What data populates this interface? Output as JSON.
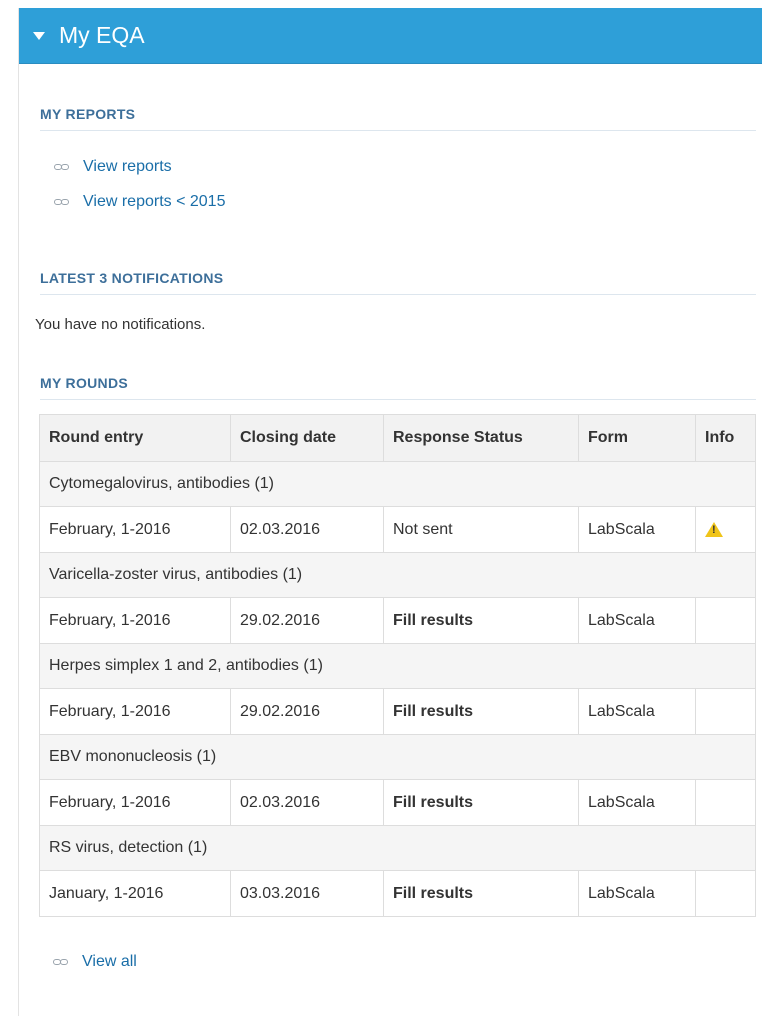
{
  "panel": {
    "title": "My EQA"
  },
  "reports": {
    "heading": "MY REPORTS",
    "links": [
      {
        "label": "View reports"
      },
      {
        "label": "View reports < 2015"
      }
    ]
  },
  "notifications": {
    "heading": "LATEST 3 NOTIFICATIONS",
    "empty_text": "You have no notifications."
  },
  "rounds": {
    "heading": "MY ROUNDS",
    "columns": [
      "Round entry",
      "Closing date",
      "Response Status",
      "Form",
      "Info"
    ],
    "groups": [
      {
        "name": "Cytomegalovirus, antibodies (1)",
        "entry": "February, 1-2016",
        "closing": "02.03.2016",
        "status": "Not sent",
        "status_type": "notsent",
        "form": "LabScala",
        "info": "warning-icon"
      },
      {
        "name": "Varicella-zoster virus, antibodies (1)",
        "entry": "February, 1-2016",
        "closing": "29.02.2016",
        "status": "Fill results",
        "status_type": "fill",
        "form": "LabScala",
        "info": ""
      },
      {
        "name": "Herpes simplex 1 and 2, antibodies (1)",
        "entry": "February, 1-2016",
        "closing": "29.02.2016",
        "status": "Fill results",
        "status_type": "fill",
        "form": "LabScala",
        "info": ""
      },
      {
        "name": "EBV mononucleosis (1)",
        "entry": "February, 1-2016",
        "closing": "02.03.2016",
        "status": "Fill results",
        "status_type": "fill",
        "form": "LabScala",
        "info": ""
      },
      {
        "name": "RS virus, detection (1)",
        "entry": "January, 1-2016",
        "closing": "03.03.2016",
        "status": "Fill results",
        "status_type": "fill",
        "form": "LabScala",
        "info": ""
      }
    ],
    "view_all": "View all"
  },
  "colors": {
    "header_bg": "#2e9fd8",
    "link": "#1a6ea8",
    "section_heading": "#3d6f9a",
    "not_sent": "#e04a3b",
    "warning": "#f0c419"
  }
}
